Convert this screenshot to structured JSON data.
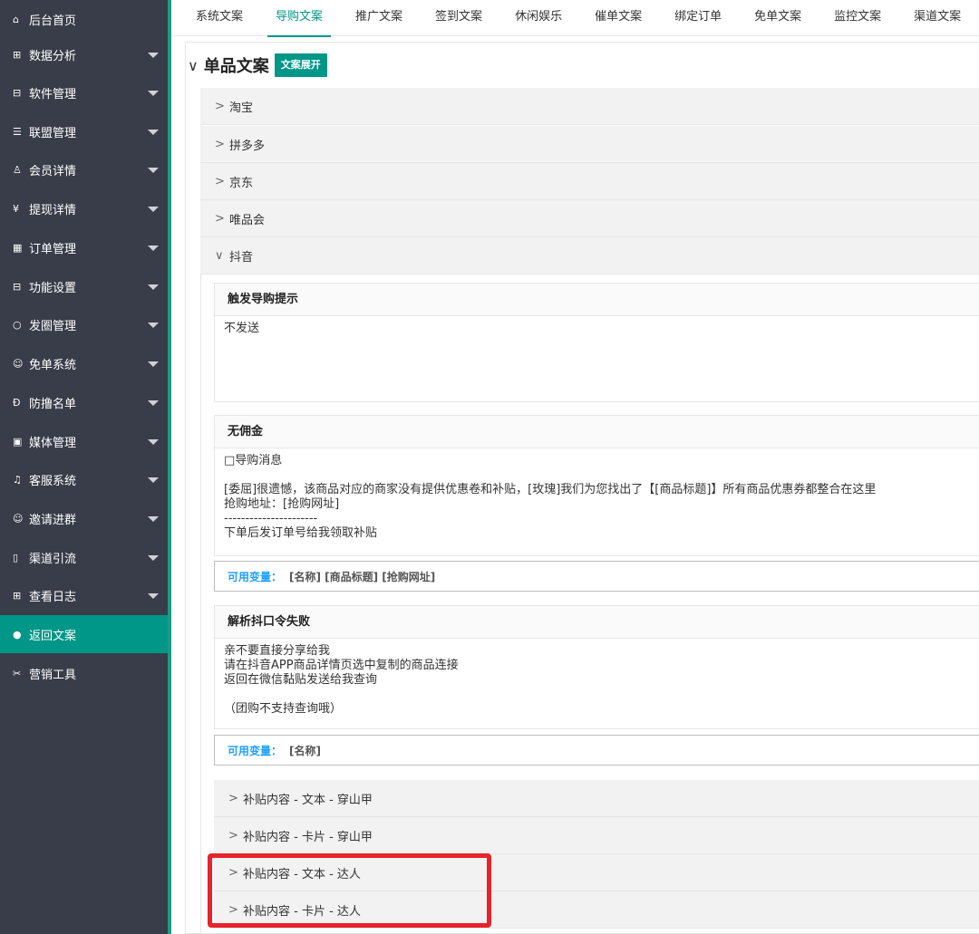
{
  "sidebar": {
    "items": [
      {
        "icon": "⌂",
        "label": "后台首页",
        "caret": false
      },
      {
        "icon": "⊞",
        "label": "数据分析",
        "caret": true
      },
      {
        "icon": "⊟",
        "label": "软件管理",
        "caret": true
      },
      {
        "icon": "☰",
        "label": "联盟管理",
        "caret": true
      },
      {
        "icon": "♙",
        "label": "会员详情",
        "caret": true
      },
      {
        "icon": "¥",
        "label": "提现详情",
        "caret": true
      },
      {
        "icon": "▦",
        "label": "订单管理",
        "caret": true
      },
      {
        "icon": "⊟",
        "label": "功能设置",
        "caret": true
      },
      {
        "icon": "○",
        "label": "发圈管理",
        "caret": true
      },
      {
        "icon": "☺",
        "label": "免单系统",
        "caret": true
      },
      {
        "icon": "Ð",
        "label": "防撸名单",
        "caret": true
      },
      {
        "icon": "▣",
        "label": "媒体管理",
        "caret": true
      },
      {
        "icon": "♫",
        "label": "客服系统",
        "caret": true
      },
      {
        "icon": "☺",
        "label": "邀请进群",
        "caret": true
      },
      {
        "icon": "▯",
        "label": "渠道引流",
        "caret": true
      },
      {
        "icon": "⊞",
        "label": "查看日志",
        "caret": true
      },
      {
        "icon": "●",
        "label": "返回文案",
        "caret": false,
        "active": true
      },
      {
        "icon": "✂",
        "label": "营销工具",
        "caret": false
      }
    ]
  },
  "tabs": [
    {
      "label": "系统文案"
    },
    {
      "label": "导购文案",
      "active": true
    },
    {
      "label": "推广文案"
    },
    {
      "label": "签到文案"
    },
    {
      "label": "休闲娱乐"
    },
    {
      "label": "催单文案"
    },
    {
      "label": "绑定订单"
    },
    {
      "label": "免单文案"
    },
    {
      "label": "监控文案"
    },
    {
      "label": "渠道文案"
    }
  ],
  "section": {
    "chevron": "∨",
    "title": "单品文案",
    "expand_label": "文案展开"
  },
  "accordion": [
    {
      "arrow": ">",
      "label": "淘宝"
    },
    {
      "arrow": ">",
      "label": "拼多多"
    },
    {
      "arrow": ">",
      "label": "京东"
    },
    {
      "arrow": ">",
      "label": "唯品会"
    },
    {
      "arrow": "∨",
      "label": "抖音"
    }
  ],
  "panels": {
    "trigger": {
      "title": "触发导购提示",
      "body": "不发送"
    },
    "no_commission": {
      "title": "无佣金",
      "body": "□导购消息\n\n[委屈]很遗憾，该商品对应的商家没有提供优惠卷和补贴，[玫瑰]我们为您找出了【[商品标题]】所有商品优惠券都整合在这里\n抢购地址：[抢购网址]\n----------------------\n下单后发订单号给我领取补贴",
      "var_key": "可用变量：",
      "var_value": "[名称] [商品标题] [抢购网址]"
    },
    "parse_fail": {
      "title": "解析抖口令失败",
      "body": "亲不要直接分享给我\n请在抖音APP商品详情页选中复制的商品连接\n返回在微信黏贴发送给我查询\n\n（团购不支持查询哦）",
      "var_key": "可用变量：",
      "var_value": "[名称]"
    }
  },
  "sub_rows": [
    {
      "arrow": ">",
      "label": "补贴内容 - 文本 - 穿山甲"
    },
    {
      "arrow": ">",
      "label": "补贴内容 - 卡片 - 穿山甲"
    },
    {
      "arrow": ">",
      "label": "补贴内容 - 文本 - 达人"
    },
    {
      "arrow": ">",
      "label": "补贴内容 - 卡片 - 达人"
    }
  ],
  "colors": {
    "sidebar_bg": "#393d49",
    "accent": "#009688",
    "variable_key": "#1e9fff",
    "highlight": "#e8232a"
  }
}
